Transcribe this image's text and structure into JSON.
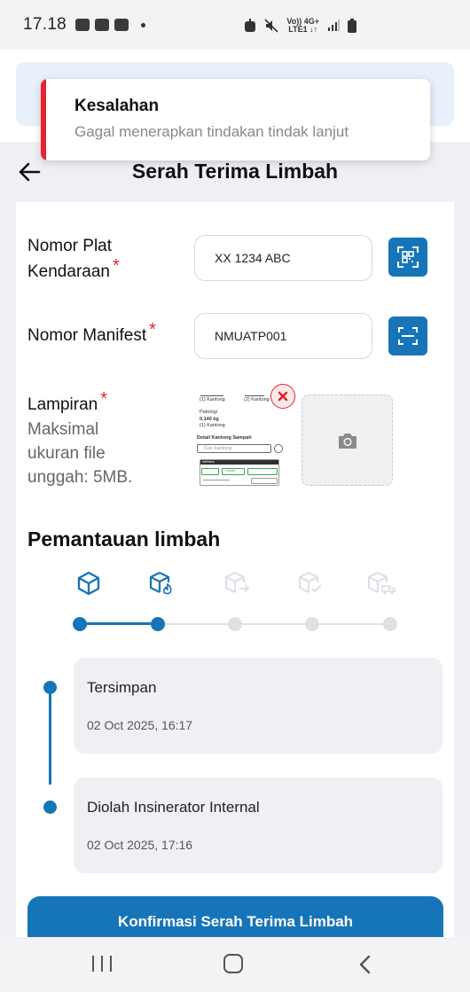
{
  "status_bar": {
    "time": "17.18",
    "net_top": "Vo)) 4G+",
    "net_bottom": "LTE1 ↓↑"
  },
  "toast": {
    "title": "Kesalahan",
    "message": "Gagal menerapkan tindakan tindak lanjut",
    "accent_color": "#e4232b"
  },
  "header": {
    "title": "Serah Terima Limbah",
    "back_icon": "arrow-left-icon"
  },
  "form": {
    "plate": {
      "label_line1": "Nomor Plat",
      "label_line2": "Kendaraan",
      "required_mark": "*",
      "value": "XX 1234 ABC",
      "action_icon": "qr-code-scan-icon"
    },
    "manifest": {
      "label": "Nomor Manifest",
      "required_mark": "*",
      "value": "NMUATP001",
      "action_icon": "barcode-scan-icon"
    },
    "attachment": {
      "label": "Lampiran",
      "required_mark": "*",
      "hint_lines": [
        "Maksimal",
        "ukuran file",
        "unggah: 5MB."
      ],
      "remove_icon": "close-circle-icon",
      "upload_icon": "camera-icon"
    }
  },
  "monitoring": {
    "title": "Pemantauan limbah",
    "steps": [
      {
        "icon": "package-icon",
        "state": "done"
      },
      {
        "icon": "package-fire-icon",
        "state": "done"
      },
      {
        "icon": "package-send-icon",
        "state": "pending"
      },
      {
        "icon": "package-check-icon",
        "state": "pending"
      },
      {
        "icon": "package-truck-icon",
        "state": "pending"
      }
    ],
    "colors": {
      "active": "#1675b9",
      "inactive": "#dde1e6"
    }
  },
  "timeline": [
    {
      "status": "Tersimpan",
      "time": "02 Oct 2025, 16:17"
    },
    {
      "status": "Diolah Insinerator Internal",
      "time": "02 Oct 2025, 17:16"
    }
  ],
  "confirm_button": {
    "label": "Konfirmasi Serah Terima Limbah"
  },
  "attachment_thumb": {
    "t1": "(1) Kantong",
    "t2": "(2) Kantong",
    "t3": "Patologi",
    "t4": "0,140 kg",
    "t5": "(1) Kantong",
    "t6": "Detail Kantong Sampah",
    "t7": "Cari kantong",
    "t8": "Infeksius",
    "t9": "Limbah"
  },
  "nav": {
    "recents_icon": "recents-icon",
    "home_icon": "home-icon",
    "back_icon": "chevron-left-icon"
  }
}
